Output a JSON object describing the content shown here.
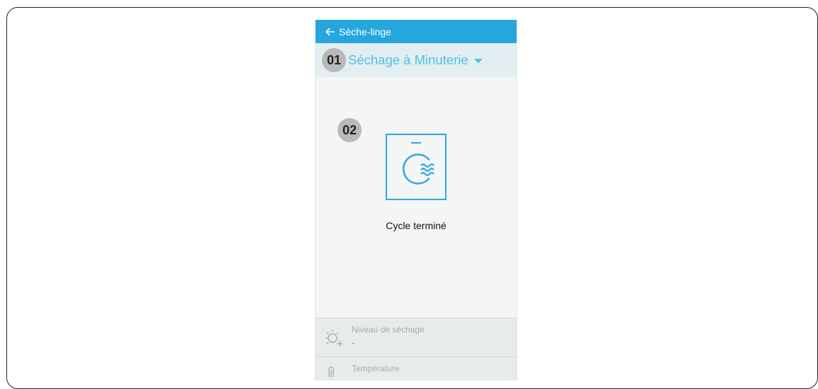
{
  "app_bar": {
    "title": "Sèche-linge",
    "back_icon": "arrow-left-icon"
  },
  "mode": {
    "badge": "01",
    "label": "Séchage à Minuterie",
    "caret_icon": "caret-down-icon"
  },
  "status": {
    "badge": "02",
    "icon": "dryer-icon",
    "text": "Cycle terminé"
  },
  "options": [
    {
      "label": "Niveau de séchage",
      "value": "-",
      "icon": "dry-level-icon"
    },
    {
      "label": "Température",
      "icon": "temperature-icon"
    }
  ],
  "colors": {
    "appbar": "#26a6df",
    "accent": "#4cc0e9",
    "icon_blue": "#29a9e1",
    "badge": "#b9b9b9",
    "background": "#f4f5f5"
  }
}
